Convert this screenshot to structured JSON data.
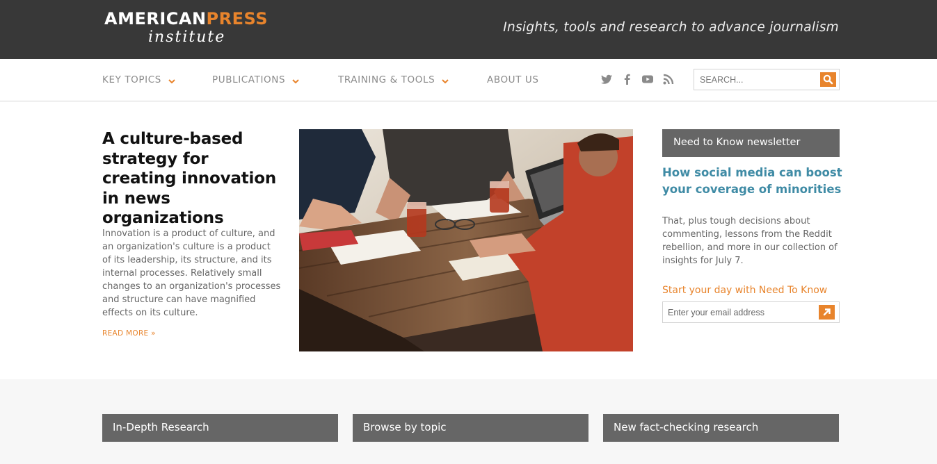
{
  "header": {
    "logo_word1": "AMERICAN",
    "logo_word2": "PRESS",
    "logo_line2": "institute",
    "tagline": "Insights, tools and research to advance journalism"
  },
  "nav": {
    "items": [
      {
        "label": "KEY TOPICS",
        "has_dropdown": true
      },
      {
        "label": "PUBLICATIONS",
        "has_dropdown": true
      },
      {
        "label": "TRAINING & TOOLS",
        "has_dropdown": true
      },
      {
        "label": "ABOUT US",
        "has_dropdown": false
      }
    ],
    "social_icons": [
      "twitter-icon",
      "facebook-icon",
      "youtube-icon",
      "rss-icon"
    ],
    "search_placeholder": "SEARCH..."
  },
  "feature": {
    "title": "A culture-based strategy for creating innovation in news organizations",
    "body": "Innovation is a product of culture, and an organization's culture is a product of its leadership, its structure, and its internal processes. Relatively small changes to an organization's processes and structure can have magnified effects on its culture.",
    "read_more": "READ MORE »"
  },
  "newsletter": {
    "header": "Need to Know newsletter",
    "headline": "How social media can boost your coverage of minorities",
    "body": "That, plus tough decisions about commenting, lessons from the Reddit rebellion, and more in our collection of insights for July 7.",
    "cta": "Start your day with Need To Know",
    "email_placeholder": "Enter your email address"
  },
  "bottom": {
    "boxes": [
      "In-Depth Research",
      "Browse by topic",
      "New fact-checking research"
    ]
  },
  "colors": {
    "accent": "#e8842c",
    "header_bg": "#383838",
    "box_bg": "#666666",
    "link_blue": "#3f8ba5"
  }
}
